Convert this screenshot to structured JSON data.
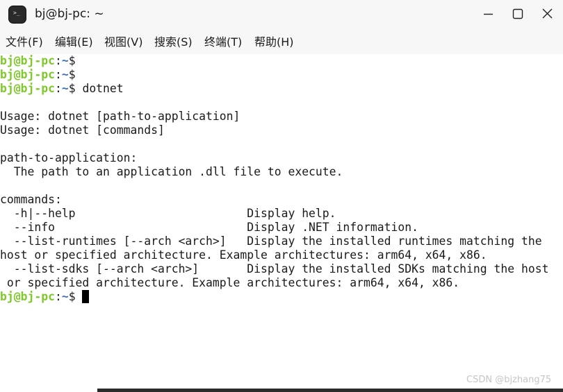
{
  "window": {
    "title": "bj@bj-pc: ~",
    "icon": "terminal-icon",
    "icon_glyph": ">_",
    "controls": [
      "minimize-icon",
      "maximize-icon",
      "close-icon"
    ]
  },
  "menu": {
    "file": "文件(F)",
    "edit": "编辑(E)",
    "view": "视图(V)",
    "search": "搜索(S)",
    "terminal": "终端(T)",
    "help": "帮助(H)"
  },
  "prompt": {
    "user": "bj@bj-pc",
    "sep": ":",
    "path": "~",
    "symbol": "$"
  },
  "lines": {
    "l0": "",
    "l1": "",
    "l2": " dotnet",
    "l4": "Usage: dotnet [path-to-application]",
    "l5": "Usage: dotnet [commands]",
    "l7": "path-to-application:",
    "l8": "  The path to an application .dll file to execute.",
    "l10": "commands:",
    "l11": "  -h|--help                         Display help.",
    "l12": "  --info                            Display .NET information.",
    "l13": "  --list-runtimes [--arch <arch>]   Display the installed runtimes matching the",
    "l14": "host or specified architecture. Example architectures: arm64, x64, x86.",
    "l15": "  --list-sdks [--arch <arch>]       Display the installed SDKs matching the host",
    "l16": " or specified architecture. Example architectures: arm64, x64, x86.",
    "l17": " "
  },
  "watermark": "CSDN @bjzhang75",
  "colors": {
    "prompt_user": "#7ec92a",
    "prompt_path": "#3c6fc9",
    "text": "#1a1a1a",
    "background": "#ffffff",
    "chrome": "#f7f7f7"
  }
}
